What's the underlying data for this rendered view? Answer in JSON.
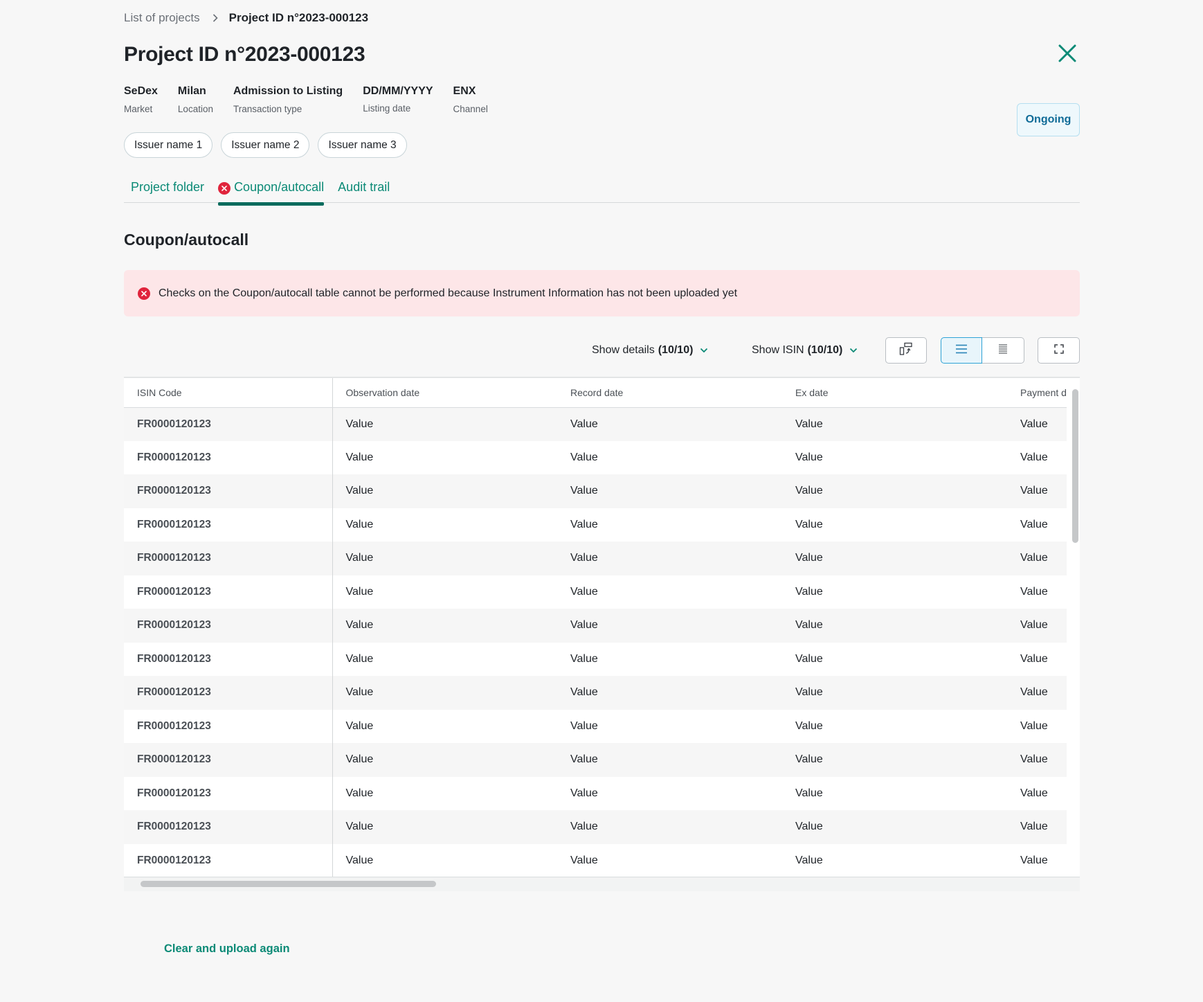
{
  "breadcrumb": {
    "parent": "List of projects",
    "current": "Project ID n°2023-000123"
  },
  "page": {
    "title": "Project ID n°2023-000123",
    "status": "Ongoing"
  },
  "meta": [
    {
      "value": "SeDex",
      "label": "Market"
    },
    {
      "value": "Milan",
      "label": "Location"
    },
    {
      "value": "Admission to Listing",
      "label": "Transaction type"
    },
    {
      "value": "DD/MM/YYYY",
      "label": "Listing date"
    },
    {
      "value": "ENX",
      "label": "Channel"
    }
  ],
  "issuers": [
    "Issuer name 1",
    "Issuer name 2",
    "Issuer name 3"
  ],
  "tabs": [
    {
      "label": "Project folder"
    },
    {
      "label": "Coupon/autocall"
    },
    {
      "label": "Audit trail"
    }
  ],
  "section": {
    "title": "Coupon/autocall"
  },
  "alert": {
    "text": "Checks on the Coupon/autocall table cannot be performed because Instrument Information has not been uploaded yet"
  },
  "toolbar": {
    "show_details_label": "Show details",
    "show_details_count": "(10/10)",
    "show_isin_label": "Show ISIN",
    "show_isin_count": "(10/10)"
  },
  "table": {
    "columns": [
      "ISIN Code",
      "Observation date",
      "Record date",
      "Ex date",
      "Payment d"
    ],
    "rows": [
      [
        "FR0000120123",
        "Value",
        "Value",
        "Value",
        "Value"
      ],
      [
        "FR0000120123",
        "Value",
        "Value",
        "Value",
        "Value"
      ],
      [
        "FR0000120123",
        "Value",
        "Value",
        "Value",
        "Value"
      ],
      [
        "FR0000120123",
        "Value",
        "Value",
        "Value",
        "Value"
      ],
      [
        "FR0000120123",
        "Value",
        "Value",
        "Value",
        "Value"
      ],
      [
        "FR0000120123",
        "Value",
        "Value",
        "Value",
        "Value"
      ],
      [
        "FR0000120123",
        "Value",
        "Value",
        "Value",
        "Value"
      ],
      [
        "FR0000120123",
        "Value",
        "Value",
        "Value",
        "Value"
      ],
      [
        "FR0000120123",
        "Value",
        "Value",
        "Value",
        "Value"
      ],
      [
        "FR0000120123",
        "Value",
        "Value",
        "Value",
        "Value"
      ],
      [
        "FR0000120123",
        "Value",
        "Value",
        "Value",
        "Value"
      ],
      [
        "FR0000120123",
        "Value",
        "Value",
        "Value",
        "Value"
      ],
      [
        "FR0000120123",
        "Value",
        "Value",
        "Value",
        "Value"
      ],
      [
        "FR0000120123",
        "Value",
        "Value",
        "Value",
        "Value"
      ]
    ]
  },
  "actions": {
    "clear_upload": "Clear and upload again"
  },
  "colors": {
    "accent": "#0b8a76",
    "error": "#e0243c",
    "alert_bg": "#fde6e8",
    "status_text": "#0f6b97",
    "status_bg": "#eef8fc"
  }
}
